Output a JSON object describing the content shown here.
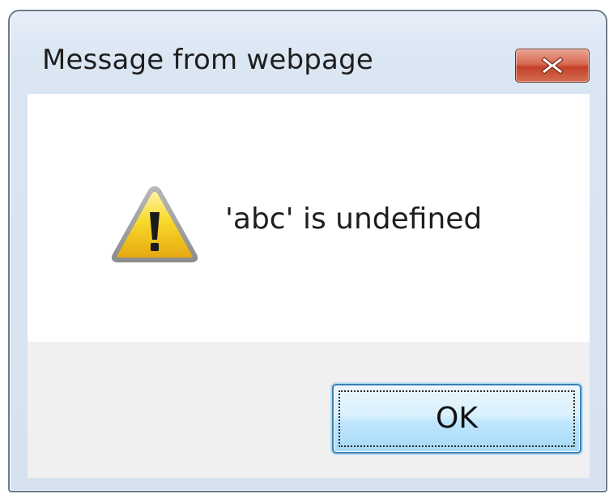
{
  "dialog": {
    "title": "Message from webpage",
    "message": "'abc' is undefined",
    "ok_label": "OK"
  },
  "icons": {
    "close": "close-x-icon",
    "warning": "warning-triangle-icon"
  },
  "colors": {
    "close_button": "#d86a52",
    "warning_fill": "#f7d21a",
    "ok_button": "#bee6fd",
    "ok_border": "#3c7fb1"
  }
}
